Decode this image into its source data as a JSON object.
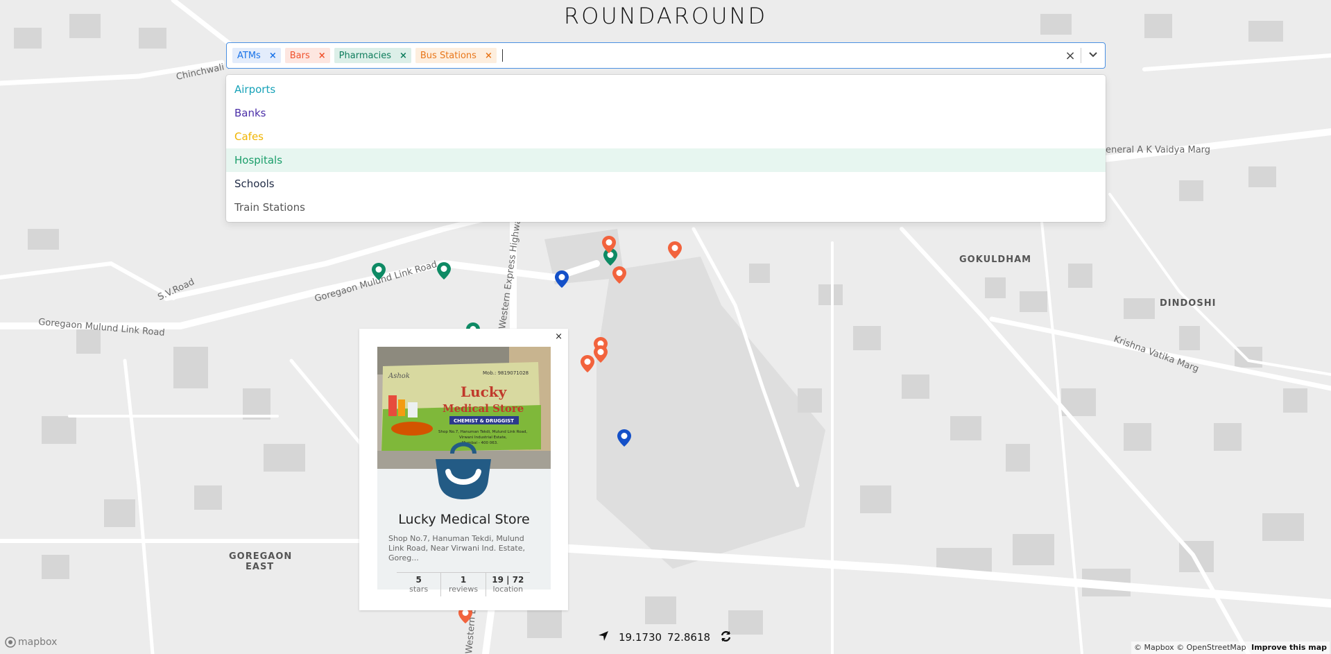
{
  "app": {
    "title": "ROUNDAROUND"
  },
  "search": {
    "selected": [
      {
        "label": "ATMs",
        "color": "#1a73e8",
        "bg": "#e3ecfb",
        "remove": "×"
      },
      {
        "label": "Bars",
        "color": "#f0522d",
        "bg": "#fde6e0",
        "remove": "×"
      },
      {
        "label": "Pharmacies",
        "color": "#0e7c5c",
        "bg": "#dcefe8",
        "remove": "×"
      },
      {
        "label": "Bus Stations",
        "color": "#e8761a",
        "bg": "#fdeede",
        "remove": "×"
      }
    ],
    "clear_icon": "×",
    "dropdown_icon": "chevron-down-icon"
  },
  "menu": {
    "options": [
      {
        "label": "Airports",
        "color": "#17a2b8"
      },
      {
        "label": "Banks",
        "color": "#4b2fa8"
      },
      {
        "label": "Cafes",
        "color": "#f0b400"
      },
      {
        "label": "Hospitals",
        "color": "#1b9e6a",
        "focused": true
      },
      {
        "label": "Schools",
        "color": "#1f2a44"
      },
      {
        "label": "Train Stations",
        "color": "#555555"
      }
    ]
  },
  "map_labels": {
    "chinchwali": "Chinchwali Road",
    "goregaon_link_1": "Goregaon Mulund Link Road",
    "goregaon_link_2": "Goregaon Mulund Link Road",
    "sv_road": "S.V.Road",
    "western_express_1": "Western Express Highway",
    "western_express_2": "Western Expr",
    "gokuldham": "GOKULDHAM",
    "dindoshi": "DINDOSHI",
    "krishna": "Krishna Vatika Marg",
    "vaidya": "eneral A K Vaidya Marg",
    "goregaon_east_1": "GOREGAON",
    "goregaon_east_2": "EAST"
  },
  "markers": [
    {
      "type": "pharmacy",
      "color": "#0e8a64"
    },
    {
      "type": "pharmacy",
      "color": "#0e8a64"
    },
    {
      "type": "pharmacy",
      "color": "#0e8a64"
    },
    {
      "type": "pharmacy",
      "color": "#0e8a64"
    },
    {
      "type": "atm",
      "color": "#1450c8"
    },
    {
      "type": "atm",
      "color": "#1450c8"
    },
    {
      "type": "bar",
      "color": "#f2633d"
    },
    {
      "type": "bar",
      "color": "#f2633d"
    },
    {
      "type": "bar",
      "color": "#f2633d"
    },
    {
      "type": "bar",
      "color": "#f2633d"
    },
    {
      "type": "bar",
      "color": "#f2633d"
    },
    {
      "type": "bar",
      "color": "#f2633d"
    },
    {
      "type": "bar",
      "color": "#f2633d"
    }
  ],
  "popup": {
    "close": "×",
    "photo": {
      "owner": "Ashok",
      "mobile": "Mob.: 9819071028",
      "line1": "Lucky",
      "line2": "Medical Store",
      "tagline": "CHEMIST & DRUGGIST",
      "shop_addr_1": "Shop No.7, Hanuman Tekdi, Mulund Link Road,",
      "shop_addr_2": "Virwani Industrial Estate,",
      "shop_addr_3": "Mumbai - 400 063."
    },
    "title": "Lucky Medical Store",
    "address": "Shop No.7, Hanuman Tekdi, Mulund Link Road, Near Virwani Ind. Estate, Goreg...",
    "stats": [
      {
        "value": "5",
        "label": "stars"
      },
      {
        "value": "1",
        "label": "reviews"
      },
      {
        "value": "19 | 72",
        "label": "location"
      }
    ]
  },
  "coords": {
    "lat": "19.1730",
    "lng": "72.8618"
  },
  "footer": {
    "logo": "mapbox",
    "attribution": "© Mapbox © OpenStreetMap",
    "improve": "Improve this map"
  }
}
